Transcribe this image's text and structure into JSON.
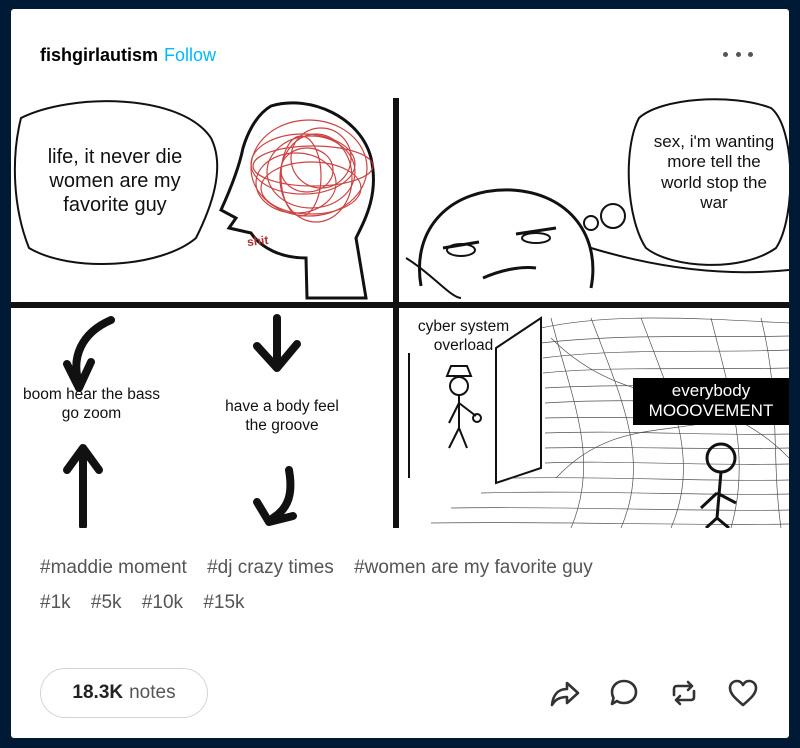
{
  "post": {
    "blog_name": "fishgirlautism",
    "follow_label": "Follow",
    "more_icon": "more-horizontal-icon"
  },
  "comic": {
    "panel1_text": "life, it never die women are my favorite guy",
    "panel1_scribble_label": "shit",
    "panel2_thought": "sex, i'm wanting more tell the world stop the war",
    "panel3_left": "boom hear the bass go zoom",
    "panel3_right": "have a body feel the groove",
    "panel4_label": "cyber system overload",
    "panel4_caption": "everybody MOOOVEMENT"
  },
  "tags": [
    "#maddie moment",
    "#dj crazy times",
    "#women are my favorite guy",
    "#1k",
    "#5k",
    "#10k",
    "#15k"
  ],
  "footer": {
    "notes_count": "18.3K",
    "notes_label": "notes",
    "actions": [
      "share-icon",
      "reply-icon",
      "reblog-icon",
      "like-icon"
    ]
  },
  "colors": {
    "background": "#001935",
    "accent": "#00b8ff",
    "card": "#ffffff"
  }
}
